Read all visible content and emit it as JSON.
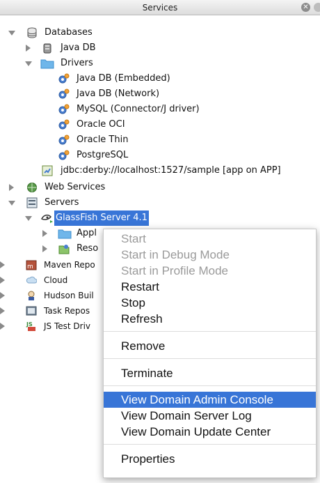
{
  "window": {
    "title": "Services"
  },
  "tree": {
    "databases": "Databases",
    "java_db": "Java DB",
    "drivers": "Drivers",
    "driver_items": [
      "Java DB (Embedded)",
      "Java DB (Network)",
      "MySQL (Connector/J driver)",
      "Oracle OCI",
      "Oracle Thin",
      "PostgreSQL"
    ],
    "connection": "jdbc:derby://localhost:1527/sample [app on APP]",
    "web_services": "Web Services",
    "servers": "Servers",
    "glassfish": "GlassFish Server 4.1",
    "applications": "Appl",
    "resources": "Reso",
    "maven": "Maven Repo",
    "cloud": "Cloud",
    "hudson": "Hudson Buil",
    "task": "Task Repos",
    "jstest": "JS Test Driv"
  },
  "context_menu": {
    "start": "Start",
    "start_debug": "Start in Debug Mode",
    "start_profile": "Start in Profile Mode",
    "restart": "Restart",
    "stop": "Stop",
    "refresh": "Refresh",
    "remove": "Remove",
    "terminate": "Terminate",
    "view_admin_console": "View Domain Admin Console",
    "view_server_log": "View Domain Server Log",
    "view_update_center": "View Domain Update Center",
    "properties": "Properties"
  },
  "colors": {
    "selection": "#3875d7",
    "disabled_text": "#9a9a9a"
  }
}
